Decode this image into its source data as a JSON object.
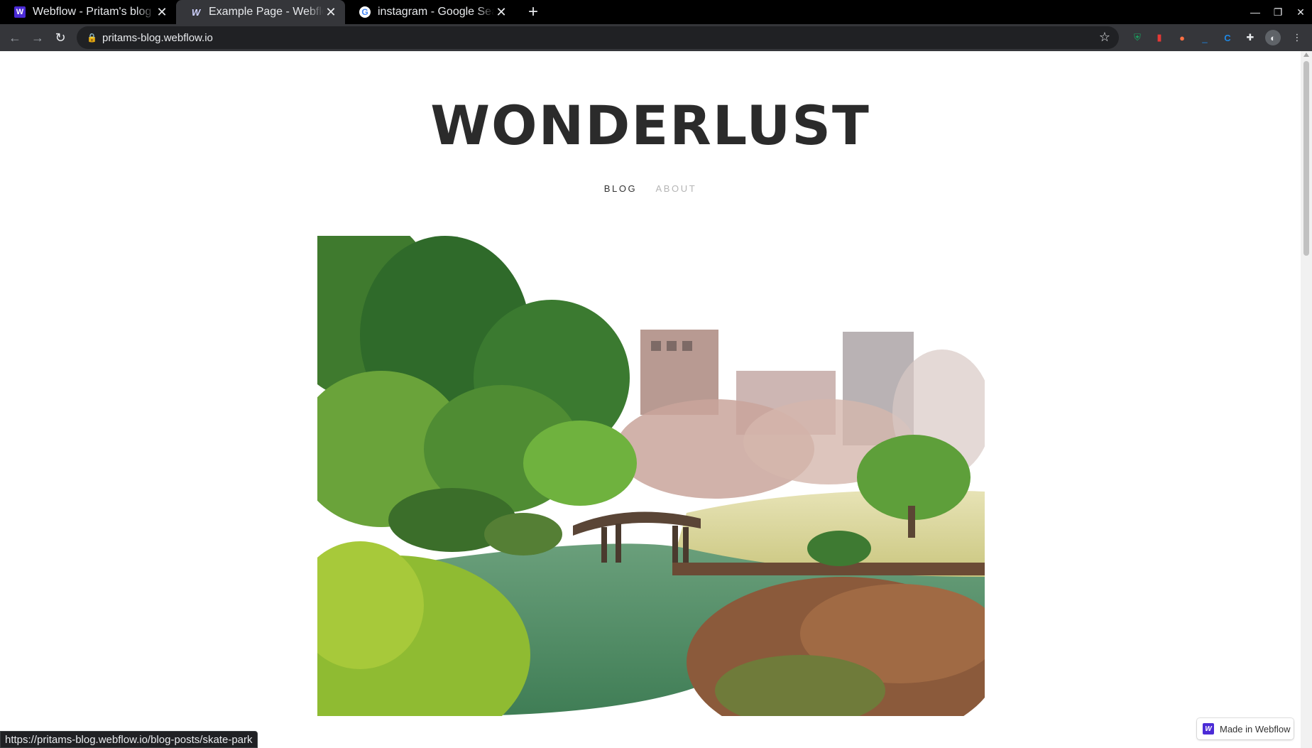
{
  "browser": {
    "tabs": [
      {
        "title": "Webflow - Pritam's blog",
        "favicon": "webflow-icon",
        "active": false
      },
      {
        "title": "Example Page - Webflow",
        "favicon": "webflow-w-icon",
        "active": true
      },
      {
        "title": "instagram - Google Search",
        "favicon": "google-icon",
        "active": false
      }
    ],
    "new_tab": "+",
    "url": "pritams-blog.webflow.io",
    "status_url": "https://pritams-blog.webflow.io/blog-posts/skate-park"
  },
  "site": {
    "title": "WONDERLUST",
    "nav": [
      {
        "label": "BLOG"
      },
      {
        "label": "ABOUT"
      }
    ],
    "hero_image": "japanese-garden-pond-photo",
    "badge": "Made in Webflow"
  },
  "colors": {
    "title": "#2b2b2b",
    "nav_active": "#333333",
    "nav_inactive": "#b5b5b5",
    "webflow_brand": "#4b2bd6"
  }
}
